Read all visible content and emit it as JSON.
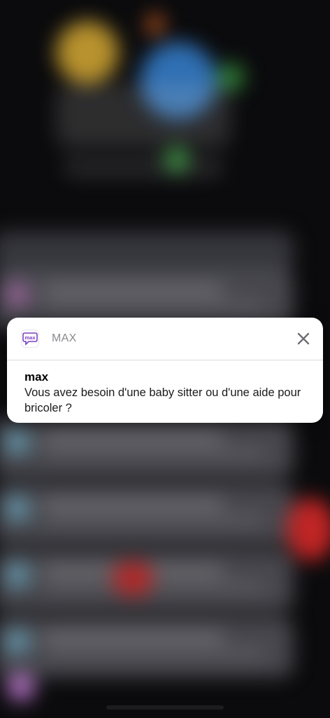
{
  "notification": {
    "app_icon": "max-app-icon",
    "app_icon_text": "max",
    "app_name": "MAX",
    "title": "max",
    "message": "Vous avez besoin d'une baby sitter ou d'une aide pour bricoler ?",
    "close_icon": "close-icon"
  },
  "colors": {
    "app_icon_accent": "#7b3fc4",
    "card_background": "#ffffff",
    "app_name_color": "#8a8a8e"
  }
}
